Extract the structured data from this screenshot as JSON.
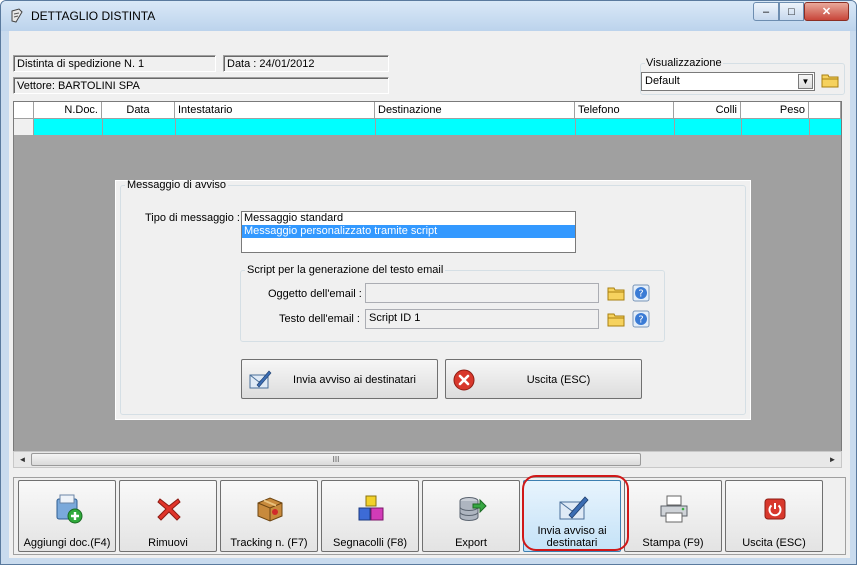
{
  "window": {
    "title": "DETTAGLIO DISTINTA",
    "controls": {
      "minimize": "–",
      "maximize": "□",
      "close": "✕"
    }
  },
  "header": {
    "distinta": "Distinta di spedizione N. 1",
    "data": "Data : 24/01/2012",
    "vettore": "Vettore: BARTOLINI SPA"
  },
  "visualizzazione": {
    "legend": "Visualizzazione",
    "selected": "Default"
  },
  "grid": {
    "columns": [
      "N.Doc.",
      "Data",
      "Intestatario",
      "Destinazione",
      "Telefono",
      "Colli",
      "Peso"
    ],
    "scrollbar_grip": "III"
  },
  "messaggio": {
    "legend": "Messaggio di avviso",
    "tipo_label": "Tipo di messaggio :",
    "options": [
      "Messaggio standard",
      "Messaggio personalizzato tramite script"
    ],
    "selected_index": 1,
    "script_legend": "Script per la generazione del testo email",
    "oggetto_label": "Oggetto dell'email :",
    "oggetto_value": "",
    "testo_label": "Testo dell'email :",
    "testo_value": "Script ID 1",
    "send_button": "Invia avviso ai destinatari",
    "exit_button": "Uscita (ESC)"
  },
  "toolbar": {
    "items": [
      {
        "label": "Aggiungi doc.(F4)",
        "icon": "add-document-icon"
      },
      {
        "label": "Rimuovi",
        "icon": "remove-x-icon"
      },
      {
        "label": "Tracking n. (F7)",
        "icon": "package-tracking-icon"
      },
      {
        "label": "Segnacolli (F8)",
        "icon": "boxes-icon"
      },
      {
        "label": "Export",
        "icon": "export-database-icon"
      },
      {
        "label": "Invia avviso ai destinatari",
        "icon": "envelope-pen-icon"
      },
      {
        "label": "Stampa (F9)",
        "icon": "printer-icon"
      },
      {
        "label": "Uscita (ESC)",
        "icon": "exit-power-icon"
      }
    ]
  },
  "colors": {
    "window_frame": "#c9dbee",
    "grid_row": "#00ffff",
    "selection": "#3399ff",
    "highlight_ring": "#d01818"
  }
}
